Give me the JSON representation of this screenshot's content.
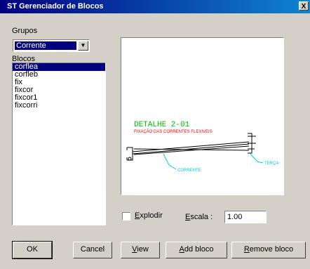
{
  "window": {
    "title": "ST Gerenciador de Blocos",
    "close_glyph": "X"
  },
  "grupos": {
    "label": "Grupos",
    "selected": "Corrente"
  },
  "blocos": {
    "label": "Blocos",
    "items": [
      "corflea",
      "corfleb",
      "fix",
      "fixcor",
      "fixcor1",
      "fixcorri"
    ],
    "selected_index": 0
  },
  "preview": {
    "detail_title": "DETALHE 2-01",
    "detail_subtitle": "FIXAÇÃO DAS CORRENTES FLEXIVEIS",
    "label_corrente": "CORRENTE",
    "label_terca": "TERÇA",
    "colors": {
      "title": "#00c000",
      "subtitle": "#ff0000",
      "labels": "#00c8ff",
      "lines": "#000000"
    }
  },
  "explodir": {
    "label": "Explodir",
    "checked": false
  },
  "escala": {
    "label": "Escala :",
    "value": "1.00"
  },
  "buttons": {
    "ok": "OK",
    "cancel": "Cancel",
    "view": "View",
    "add_bloco": "Add bloco",
    "remove_bloco": "Remove bloco"
  }
}
